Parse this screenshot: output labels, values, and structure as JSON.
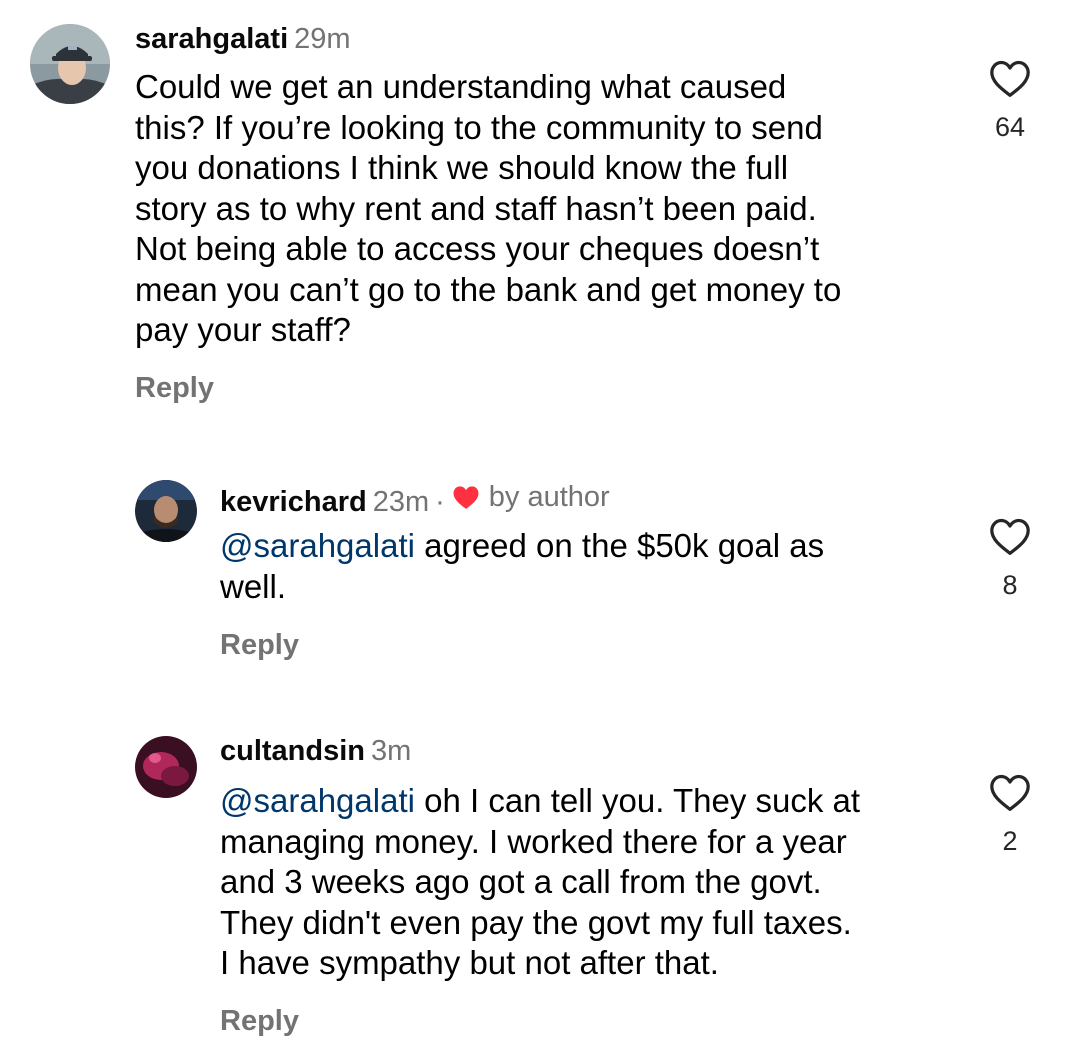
{
  "comments": [
    {
      "username": "sarahgalati",
      "time": "29m",
      "lines": [
        "Could we get an understanding what caused",
        "this? If you’re looking to the community to send",
        "you donations I think we should know the full",
        "story as to why rent and staff hasn’t been paid.",
        "Not being able to access your cheques doesn’t",
        "mean you can’t go to the bank and get money to",
        "pay your staff?"
      ],
      "reply_label": "Reply",
      "likes": "64"
    },
    {
      "username": "kevrichard",
      "time": "23m",
      "separator": "·",
      "badge": "by author",
      "mention": "@sarahgalati",
      "lines_after_mention": [
        " agreed on the $50k goal as",
        "well."
      ],
      "reply_label": "Reply",
      "likes": "8"
    },
    {
      "username": "cultandsin",
      "time": "3m",
      "mention": "@sarahgalati",
      "lines_after_mention": [
        " oh I can tell you. They suck at",
        "managing money. I worked there for a year",
        "and 3 weeks ago got a call from the govt.",
        "They didn't even pay the govt my full taxes.",
        "I have sympathy but not after that."
      ],
      "reply_label": "Reply",
      "likes": "2"
    }
  ],
  "icons": {
    "like": "heart-outline-icon",
    "author_like": "heart-filled-icon"
  },
  "colors": {
    "mention": "#00376b",
    "secondary_text": "#737373",
    "author_heart": "#ff3040"
  }
}
